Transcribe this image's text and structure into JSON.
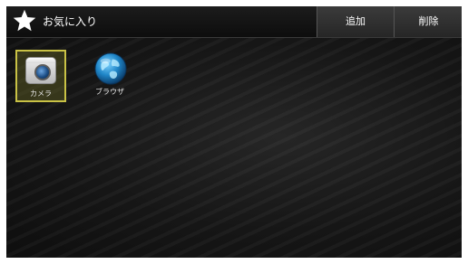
{
  "header": {
    "title": "お気に入り",
    "title_icon": "star-icon",
    "add_label": "追加",
    "delete_label": "削除"
  },
  "apps": [
    {
      "label": "カメラ",
      "icon": "camera-icon",
      "selected": true
    },
    {
      "label": "ブラウザ",
      "icon": "globe-icon",
      "selected": false
    }
  ],
  "colors": {
    "background": "#121212",
    "selection_border": "#c9c245",
    "header_button": "#303030"
  }
}
